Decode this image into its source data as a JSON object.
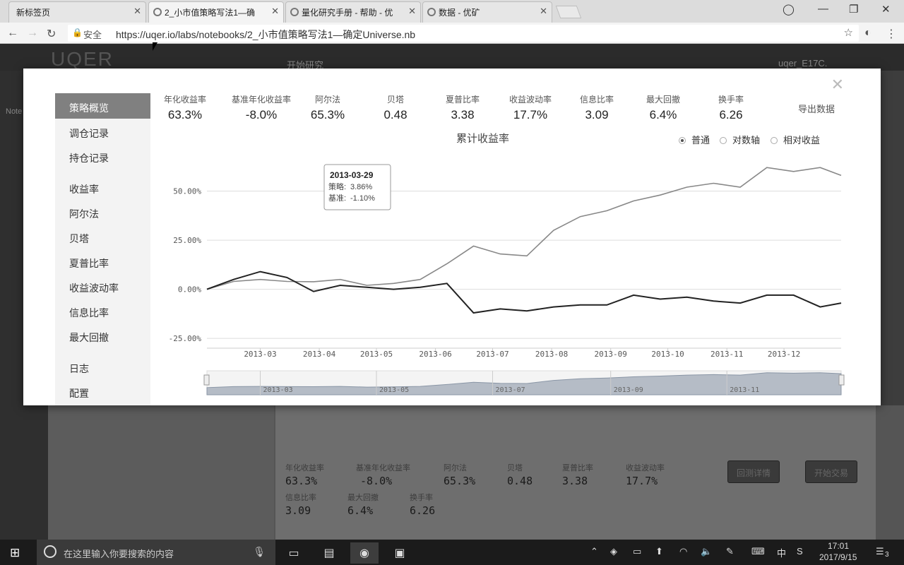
{
  "browser": {
    "tabs": [
      {
        "label": "新标签页",
        "active": false
      },
      {
        "label": "2_小市值策略写法1—确",
        "active": true
      },
      {
        "label": "量化研究手册 - 帮助 - 优",
        "active": false
      },
      {
        "label": "数据 - 优矿",
        "active": false
      }
    ],
    "secure_label": "安全",
    "url": "https://uqer.io/labs/notebooks/2_小市值策略写法1—确定Universe.nb"
  },
  "page": {
    "logo": "UQER",
    "nav_start": "开始研究",
    "user": "uqer_E17C.",
    "notebook_label": "Note",
    "bottom_stats": [
      {
        "label": "年化收益率",
        "value": "63.3%"
      },
      {
        "label": "基准年化收益率",
        "value": "-8.0%"
      },
      {
        "label": "阿尔法",
        "value": "65.3%"
      },
      {
        "label": "贝塔",
        "value": "0.48"
      },
      {
        "label": "夏普比率",
        "value": "3.38"
      },
      {
        "label": "收益波动率",
        "value": "17.7%"
      },
      {
        "label": "信息比率",
        "value": "3.09"
      },
      {
        "label": "最大回撤",
        "value": "6.4%"
      },
      {
        "label": "换手率",
        "value": "6.26"
      }
    ],
    "btn_backtest": "回测详情",
    "btn_trade": "开始交易"
  },
  "modal": {
    "menu": [
      {
        "label": "策略概览",
        "active": true
      },
      {
        "label": "调仓记录",
        "active": false
      },
      {
        "label": "持仓记录",
        "active": false
      },
      {
        "label": "收益率",
        "active": false
      },
      {
        "label": "阿尔法",
        "active": false
      },
      {
        "label": "贝塔",
        "active": false
      },
      {
        "label": "夏普比率",
        "active": false
      },
      {
        "label": "收益波动率",
        "active": false
      },
      {
        "label": "信息比率",
        "active": false
      },
      {
        "label": "最大回撤",
        "active": false
      },
      {
        "label": "日志",
        "active": false
      },
      {
        "label": "配置",
        "active": false
      }
    ],
    "stats": [
      {
        "label": "年化收益率",
        "value": "63.3%"
      },
      {
        "label": "基准年化收益率",
        "value": "-8.0%"
      },
      {
        "label": "阿尔法",
        "value": "65.3%"
      },
      {
        "label": "贝塔",
        "value": "0.48"
      },
      {
        "label": "夏普比率",
        "value": "3.38"
      },
      {
        "label": "收益波动率",
        "value": "17.7%"
      },
      {
        "label": "信息比率",
        "value": "3.09"
      },
      {
        "label": "最大回撤",
        "value": "6.4%"
      },
      {
        "label": "换手率",
        "value": "6.26"
      }
    ],
    "export_label": "导出数据",
    "radio_options": [
      {
        "label": "普通",
        "selected": true
      },
      {
        "label": "对数轴",
        "selected": false
      },
      {
        "label": "相对收益",
        "selected": false
      }
    ],
    "tooltip": {
      "date": "2013-03-29",
      "strategy_label": "策略:",
      "strategy_value": "3.86%",
      "benchmark_label": "基准:",
      "benchmark_value": "-1.10%"
    }
  },
  "chart_data": {
    "type": "line",
    "title": "累计收益率",
    "x": [
      "2013-02-01",
      "2013-02-15",
      "2013-03-01",
      "2013-03-15",
      "2013-03-29",
      "2013-04-12",
      "2013-04-26",
      "2013-05-10",
      "2013-05-24",
      "2013-06-07",
      "2013-06-21",
      "2013-07-05",
      "2013-07-19",
      "2013-08-02",
      "2013-08-16",
      "2013-08-30",
      "2013-09-13",
      "2013-09-27",
      "2013-10-11",
      "2013-10-25",
      "2013-11-08",
      "2013-11-22",
      "2013-12-06",
      "2013-12-20",
      "2013-12-31"
    ],
    "series": [
      {
        "name": "策略",
        "color": "#888888",
        "values": [
          0,
          4,
          5,
          4,
          3.86,
          5,
          2,
          3,
          5,
          13,
          22,
          18,
          17,
          30,
          37,
          40,
          45,
          48,
          52,
          54,
          52,
          62,
          60,
          62,
          58
        ]
      },
      {
        "name": "基准",
        "color": "#222222",
        "values": [
          0,
          5,
          9,
          6,
          -1.1,
          2,
          1,
          0,
          1,
          3,
          -12,
          -10,
          -11,
          -9,
          -8,
          -8,
          -3,
          -5,
          -4,
          -6,
          -7,
          -3,
          -3,
          -9,
          -7
        ]
      }
    ],
    "ylim": [
      -30,
      70
    ],
    "yticks": [
      "-25.00%",
      "0.00%",
      "25.00%",
      "50.00%"
    ],
    "ytick_values": [
      -25,
      0,
      25,
      50
    ],
    "xticks": [
      "2013-03",
      "2013-04",
      "2013-05",
      "2013-06",
      "2013-07",
      "2013-08",
      "2013-09",
      "2013-10",
      "2013-11",
      "2013-12"
    ],
    "xtick_values": [
      "2013-03-01",
      "2013-04-01",
      "2013-05-01",
      "2013-06-01",
      "2013-07-01",
      "2013-08-01",
      "2013-09-01",
      "2013-10-01",
      "2013-11-01",
      "2013-12-01"
    ],
    "navigator_ticks": [
      "2013-03",
      "2013-05",
      "2013-07",
      "2013-09",
      "2013-11"
    ],
    "navigator_tick_values": [
      "2013-03-01",
      "2013-05-01",
      "2013-07-01",
      "2013-09-01",
      "2013-11-01"
    ],
    "grid": true
  },
  "taskbar": {
    "search_placeholder": "在这里输入你要搜索的内容",
    "ime": "中",
    "time": "17:01",
    "date": "2017/9/15",
    "notif_count": "3"
  }
}
